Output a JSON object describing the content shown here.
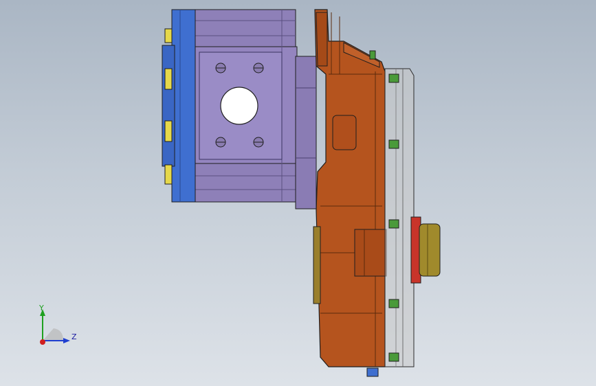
{
  "view": {
    "background_top": "#aab6c4",
    "background_bottom": "#dde2e8"
  },
  "colors": {
    "pump_body": "#8e80b8",
    "pump_body_dark": "#6f62a0",
    "end_cap": "#3f6fd0",
    "housing": "#b5541e",
    "housing_dark": "#7a3410",
    "bolt": "#e6d84a",
    "cover": "#c8c8c8",
    "seal": "#c8342a",
    "shaft": "#a08a2c",
    "outline": "#1e1e1e"
  },
  "triad": {
    "y_label": "Y",
    "z_label": "Z",
    "y_color": "#1fa01f",
    "z_color": "#1f3fd0",
    "x_color": "#d01f1f"
  }
}
